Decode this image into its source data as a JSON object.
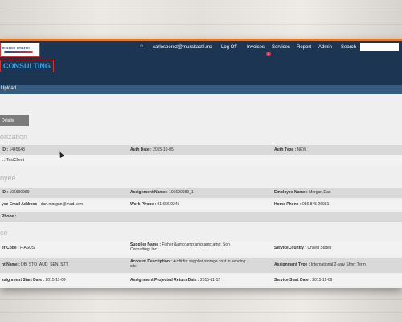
{
  "header": {
    "logo_text": "mission amazon",
    "brand": "CONSULTING",
    "nav": [
      "carlosperez@muraltactil.mx",
      "Log Off",
      "Invoices",
      "Services",
      "Report",
      "Admin",
      "Search"
    ],
    "invoice_badge": "4"
  },
  "subnav": {
    "upload": "Upload"
  },
  "tabs": [
    "Details",
    "",
    ""
  ],
  "sections": {
    "authorization": "orization",
    "employee": "oyee",
    "supplier": "ce"
  },
  "auth": {
    "id_label": "ID :",
    "id_value": "1445643",
    "auth_date_label": "Auth Date :",
    "auth_date_value": "2015-10-05",
    "auth_type_label": "Auth Type :",
    "auth_type_value": "NEW",
    "client_label": "t :",
    "client_value": "TestClient"
  },
  "employee": {
    "id_label": "ID :",
    "id_value": "105690989",
    "assignment_name_label": "Assignment Name :",
    "assignment_name_value": "105690989_1",
    "employee_name_label": "Employee Name :",
    "employee_name_value": "Morgan,Dan",
    "email_label": "yee Email Address :",
    "email_value": "dan.morgan@mud.com",
    "work_phone_label": "Work Phone :",
    "work_phone_value": "01 656 9245",
    "home_phone_label": "Home Phone :",
    "home_phone_value": "086 845 26981",
    "phone_label": "Phone :",
    "phone_value": ""
  },
  "supplier": {
    "code_label": "er Code :",
    "code_value": "FIASUS",
    "name_label": "Supplier Name :",
    "name_value": "Fisher &amp;amp;amp;amp;amp; Son Consulting, Inc.",
    "country_label": "ServiceCountry :",
    "country_value": "United States",
    "assignment_label": "nt Name :",
    "assignment_value": "DB_STO_AUD_SEN_STT",
    "desc_label": "Account Description :",
    "desc_value": "Audit for supplier storage cost in sending site",
    "type_label": "Assignment Type :",
    "type_value": "International 2-way Short Term",
    "start_label": "ssignment Start Date :",
    "start_value": "2015-11-09",
    "return_label": "Assignment Projected Return Date :",
    "return_value": "2015-11-12",
    "service_start_label": "Service Start Date :",
    "service_start_value": "2015-11-09"
  }
}
